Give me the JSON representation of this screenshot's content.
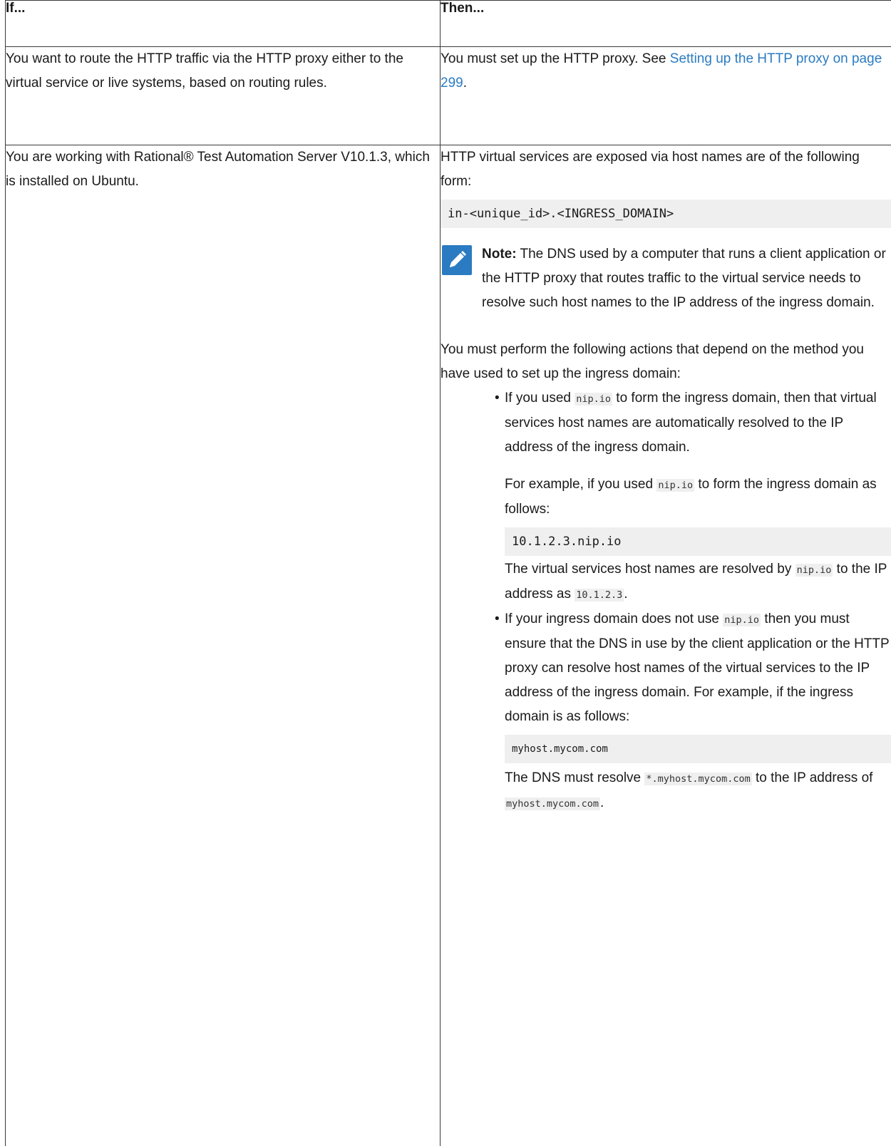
{
  "table": {
    "header_if": "If...",
    "header_then": "Then..."
  },
  "row1": {
    "if_text": "You want to route the HTTP traffic via the HTTP proxy ei­ther to the virtual service or live systems, based on rout­ing rules.",
    "then_prefix": "You must set up the HTTP proxy. See ",
    "then_link": "Setting up the HTTP proxy on page 299",
    "then_suffix": "."
  },
  "row2": {
    "if_text": "You are working with Rational® Test Automation Server V10.1.3, which is installed on Ubuntu.",
    "intro": "HTTP virtual services are exposed via host names are of the following form:",
    "code_hostform": "in-<unique_id>.<INGRESS_DOMAIN>",
    "note_label": "Note:",
    "note_text": " The DNS used by a computer that runs a client application or the HTTP proxy that routes traffic to the virtual service needs to resolve such host names to the IP address of the ingress domain.",
    "actions_intro": "You must perform the following actions that depend on the method you have used to set up the ingress domain:",
    "b1_p1": "If you used ",
    "b1_code": "nip.io",
    "b1_p2": " to form the ingress domain, then that virtual services host names are au­tomatically resolved to the IP address of the ingress domain.",
    "b1_ex1": "For example, if you used ",
    "b1_ex_code": "nip.io",
    "b1_ex2": " to form the ingress domain as follows:",
    "b1_codeblock": "10.1.2.3.nip.io",
    "b1_res1": "The virtual services host names are resolved by ",
    "b1_res_code1": "nip.io",
    "b1_res2": " to the IP address as ",
    "b1_res_code2": "10.1.2.3",
    "b1_res3": ".",
    "b2_p1": "If your ingress domain does not use ",
    "b2_code": "nip.io",
    "b2_p2": " then you must ensure that the DNS in use by the client application or the HTTP proxy can resolve host names of the virtual services to the IP address of the ingress domain. For example, if the ingress domain is as follows:",
    "b2_codeblock": "myhost.mycom.com",
    "b2_res1": "The DNS must resolve ",
    "b2_res_code1": "*.myhost.mycom.com",
    "b2_res2": " to the IP address of ",
    "b2_res_code2": "myhost.mycom.com",
    "b2_res3": "."
  },
  "icons": {
    "note": "pencil-note-icon"
  },
  "colors": {
    "link": "#2a7bc1",
    "note_icon": "#2a7bc1",
    "code_bg": "#efefef"
  }
}
